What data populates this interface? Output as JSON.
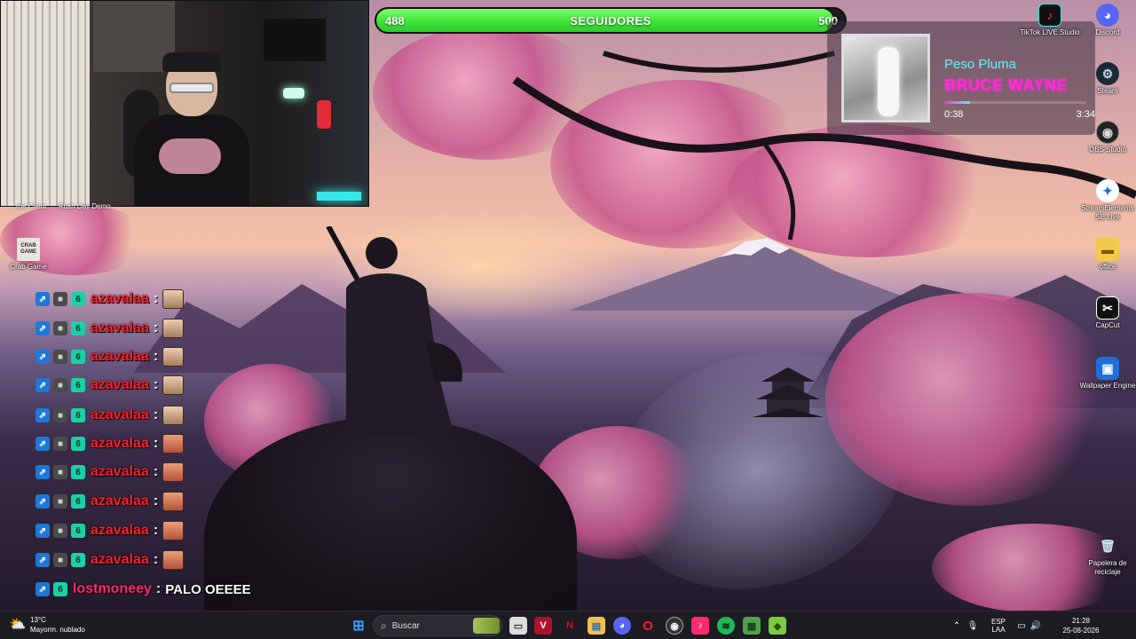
{
  "follower_goal": {
    "current": "488",
    "label": "SEGUIDORES",
    "target": "500",
    "progress": 0.976
  },
  "now_playing": {
    "artist": "Peso Pluma",
    "title": "BRUCE WAYNE",
    "elapsed": "0:38",
    "duration": "3:34",
    "progress": 0.18
  },
  "desktop_icons": {
    "tiktok_live": "TikTok LIVE Studio",
    "discord": "Discord",
    "steam": "Steam",
    "obs": "OBS Studio",
    "streamelements": "StreamElements SE.Live",
    "office": "office",
    "capcut": "CapCut",
    "wallpaper_engine": "Wallpaper Engine",
    "recycle_bin": "Papelera de reciclaje",
    "crab_game": "Crab Game",
    "crab_game_logo": "CRAB GAME",
    "partial_left": "…roe Client",
    "partial_mid": "Rush Day Demo"
  },
  "chat": {
    "messages": [
      {
        "user": "azavalaa",
        "separator": ":",
        "message": ""
      },
      {
        "user": "azavalaa",
        "separator": ":",
        "message": ""
      },
      {
        "user": "azavalaa",
        "separator": ":",
        "message": ""
      },
      {
        "user": "azavalaa",
        "separator": ":",
        "message": ""
      },
      {
        "user": "azavalaa",
        "separator": ":",
        "message": ""
      },
      {
        "user": "azavalaa",
        "separator": ":",
        "message": ""
      },
      {
        "user": "azavalaa",
        "separator": ":",
        "message": ""
      },
      {
        "user": "azavalaa",
        "separator": ":",
        "message": ""
      },
      {
        "user": "azavalaa",
        "separator": ":",
        "message": ""
      },
      {
        "user": "azavalaa",
        "separator": ":",
        "message": ""
      }
    ],
    "last": {
      "user": "lostmoneey",
      "separator": ":",
      "message": "PALO OEEEE"
    }
  },
  "taskbar": {
    "weather_temp": "13°C",
    "weather_desc": "Mayorm. nublado",
    "search_placeholder": "Buscar",
    "lang_top": "ESP",
    "lang_bottom": "LAA",
    "time": "21:28",
    "date": "25-08-2026"
  },
  "colors": {
    "goal_green": "#3fe338",
    "chat_user_red": "#ff1d2e",
    "track_title_magenta": "#ff2bd6",
    "track_artist_cyan": "#62f0ff"
  }
}
